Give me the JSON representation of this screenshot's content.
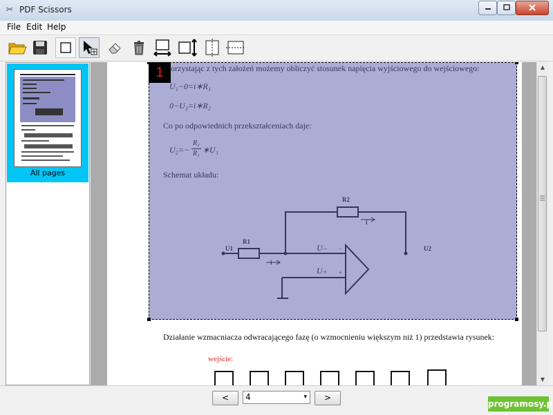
{
  "window": {
    "title": "PDF Scissors",
    "min_label": "▭",
    "max_label": "▢",
    "close_label": "✕"
  },
  "menu": {
    "items": [
      "File",
      "Edit",
      "Help"
    ]
  },
  "toolbar": {
    "tools": [
      "open-folder-icon",
      "save-icon",
      "new-selection-icon",
      "select-pointer-icon",
      "eraser-icon",
      "delete-icon",
      "equal-width-icon",
      "equal-height-icon",
      "split-vertical-icon",
      "split-horizontal-icon"
    ]
  },
  "sidebar": {
    "thumbnail_label": "All pages"
  },
  "document": {
    "line1": "orzystając z tych założeń możemy obliczyć stosunek napięcia wyjściowego do wejściowego:",
    "eq1": "U₁−0=i∗R₁",
    "eq2": "0−U₂=i∗R₂",
    "line2": "Co po odpowiednich przekształceniach daje:",
    "eq3_left": "U₂=−",
    "eq3_num": "R₂",
    "eq3_den": "R₁",
    "eq3_right": "∗U₁",
    "line3": "Schemat układu:",
    "circuit": {
      "r1": "R1",
      "r2": "R2",
      "u1": "U1",
      "u2": "U2",
      "i": "i",
      "u_minus": "U₋",
      "u_plus": "U₊",
      "minus": "−",
      "plus": "+"
    },
    "line4": "Działanie wzmacniacza odwracającego fazę (o wzmocnieniu większym niż 1) przedstawia rysunek:",
    "input_label": "wejście:"
  },
  "selection": {
    "number": "1",
    "color": "#5a5caa"
  },
  "nav": {
    "prev_label": "<",
    "next_label": ">",
    "page_value": "4",
    "caret": "▾"
  },
  "watermark": "programosy.pl",
  "colors": {
    "sidebar_highlight": "#00c5f5",
    "watermark_bg": "#6fc234"
  }
}
